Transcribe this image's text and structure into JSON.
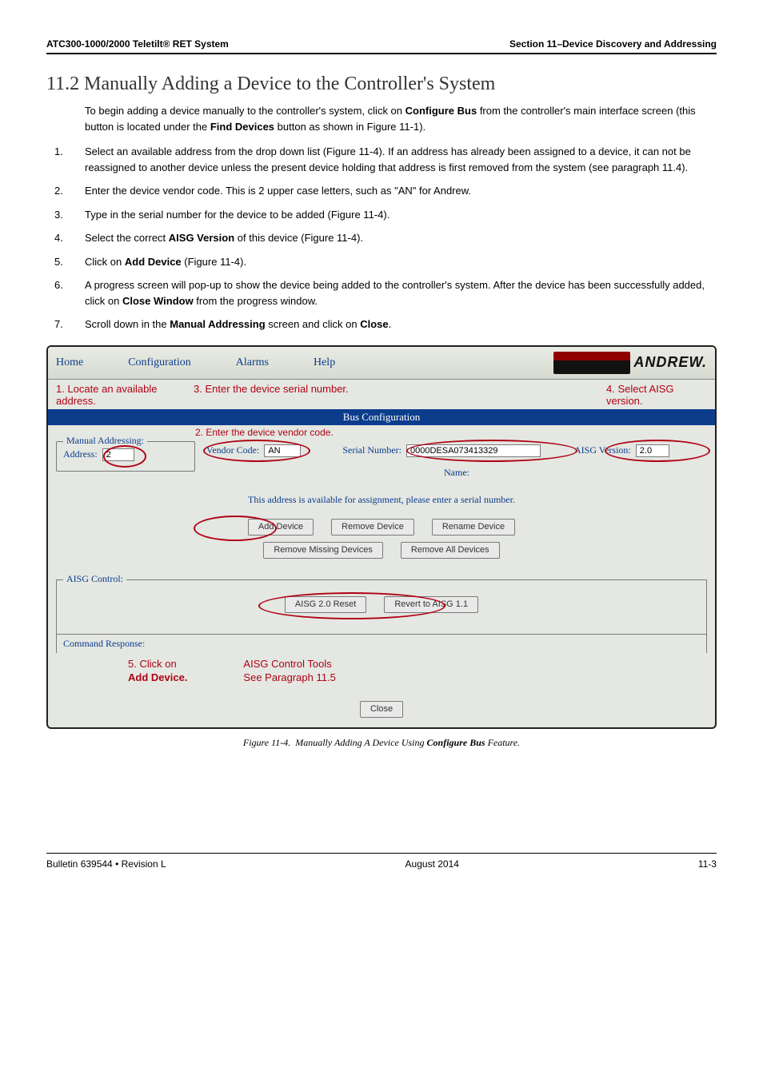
{
  "header": {
    "left": "ATC300-1000/2000 Teletilt® RET System",
    "right": "Section 11–Device Discovery and Addressing"
  },
  "section_title": "11.2 Manually Adding a Device to the Controller's System",
  "intro": "To begin adding a device manually to the controller's system, click on Configure Bus from the controller's main interface screen (this button is located under the Find Devices button as shown in Figure 11-1).",
  "steps": [
    "Select an available address from the drop down list (Figure 11-4). If an address has already been assigned to a device, it can not be reassigned to another device unless the present device holding that address is first removed from the system (see paragraph 11.4).",
    "Enter the device vendor code. This is 2 upper case letters, such as \"AN\" for Andrew.",
    "Type in the serial number for the device to be added (Figure 11-4).",
    "Select the correct AISG Version of this device (Figure 11-4).",
    "Click on Add Device (Figure 11-4).",
    "A progress screen will pop-up to show the device being added to the controller's system. After the device has been successfully added, click on Close Window from the progress window.",
    "Scroll down in the Manual Addressing screen and click on Close."
  ],
  "app": {
    "menu": {
      "home": "Home",
      "config": "Configuration",
      "alarms": "Alarms",
      "help": "Help"
    },
    "logo_text": "ANDREW.",
    "annotations": {
      "a1": "1. Locate an available address.",
      "a3": "3. Enter the device serial number.",
      "a4": "4. Select AISG version.",
      "a2": "2. Enter the device vendor code.",
      "a5_line1": "5. Click on",
      "a5_line2": "Add Device.",
      "tools_line1": "AISG Control Tools",
      "tools_line2": "See Paragraph 11.5"
    },
    "blue_bar": "Bus Configuration",
    "manual_addressing_legend": "Manual Addressing:",
    "labels": {
      "address": "Address:",
      "vendor_code": "Vendor Code:",
      "serial_number": "Serial Number:",
      "name": "Name:",
      "aisg_version": "AISG Version:"
    },
    "values": {
      "address": "2",
      "vendor_code": "AN",
      "serial_number": "0000DESA073413329",
      "aisg_version": "2.0"
    },
    "msg": "This address is available for assignment, please enter a serial number.",
    "buttons": {
      "add_device": "Add Device",
      "remove_device": "Remove Device",
      "rename_device": "Rename Device",
      "remove_missing": "Remove Missing Devices",
      "remove_all": "Remove All Devices",
      "aisg_reset": "AISG 2.0 Reset",
      "revert": "Revert to AISG 1.1",
      "close": "Close"
    },
    "aisg_control_legend": "AISG Control:",
    "command_response": "Command Response:"
  },
  "fig_caption": "Figure 11-4.  Manually Adding A Device Using Configure Bus Feature.",
  "footer": {
    "left": "Bulletin 639544  •  Revision L",
    "center": "August 2014",
    "right": "11-3"
  }
}
